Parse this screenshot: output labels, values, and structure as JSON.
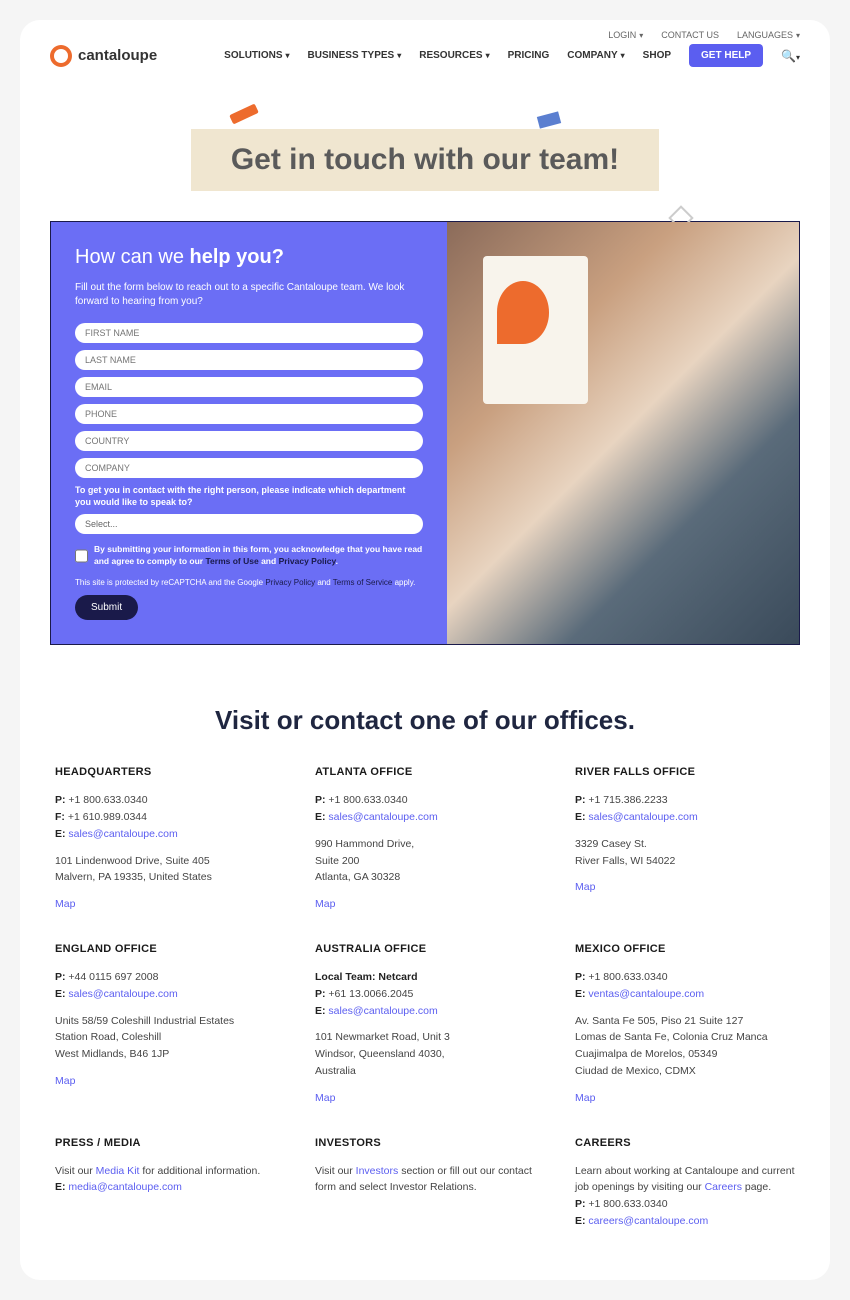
{
  "topbar": {
    "login": "LOGIN",
    "contact": "CONTACT US",
    "languages": "LANGUAGES"
  },
  "nav": {
    "logo": "cantaloupe",
    "items": [
      "SOLUTIONS",
      "BUSINESS TYPES",
      "RESOURCES",
      "PRICING",
      "COMPANY",
      "SHOP"
    ],
    "gethelp": "GET HELP"
  },
  "hero": {
    "title": "Get in touch with our team!"
  },
  "form": {
    "title_plain": "How can we ",
    "title_bold": "help you?",
    "desc": "Fill out the form below to reach out to a specific Cantaloupe team. We look forward to hearing from you?",
    "first": "FIRST NAME",
    "last": "LAST NAME",
    "email": "EMAIL",
    "phone": "PHONE",
    "country": "COUNTRY",
    "company": "COMPANY",
    "dept_label": "To get you in contact with the right person, please indicate which department you would like to speak to?",
    "select": "Select...",
    "consent_pre": "By submitting your information in this form, you acknowledge that you have read and agree to comply to our",
    "terms": "Terms of Use",
    "and": " and ",
    "privacy": "Privacy Policy",
    "captcha_pre": "This site is protected by reCAPTCHA and the Google ",
    "captcha_pp": "Privacy Policy",
    "captcha_and": " and ",
    "captcha_tos": "Terms of Service",
    "captcha_post": " apply.",
    "submit": "Submit"
  },
  "offices_title": "Visit or contact one of our offices.",
  "offices": [
    {
      "name": "HEADQUARTERS",
      "lines": [
        "P: +1 800.633.0340",
        "F: +1 610.989.0344"
      ],
      "email_label": "E: ",
      "email": "sales@cantaloupe.com",
      "addr": [
        "101 Lindenwood Drive, Suite 405",
        "Malvern, PA 19335, United States"
      ],
      "map": "Map"
    },
    {
      "name": "ATLANTA OFFICE",
      "lines": [
        "P: +1 800.633.0340"
      ],
      "email_label": "E: ",
      "email": "sales@cantaloupe.com",
      "addr": [
        "990 Hammond Drive,",
        "Suite 200",
        "Atlanta, GA 30328"
      ],
      "map": "Map"
    },
    {
      "name": "RIVER FALLS OFFICE",
      "lines": [
        "P: +1 715.386.2233"
      ],
      "email_label": "E: ",
      "email": "sales@cantaloupe.com",
      "addr": [
        "3329 Casey St.",
        "River Falls, WI 54022"
      ],
      "map": "Map"
    },
    {
      "name": "ENGLAND OFFICE",
      "lines": [
        "P: +44 0115 697 2008"
      ],
      "email_label": "E: ",
      "email": "sales@cantaloupe.com",
      "addr": [
        "Units 58/59 Coleshill Industrial Estates",
        "Station Road, Coleshill",
        "West Midlands, B46 1JP"
      ],
      "map": "Map"
    },
    {
      "name": "AUSTRALIA OFFICE",
      "local": "Local Team: Netcard",
      "lines": [
        "P: +61 13.0066.2045"
      ],
      "email_label": "E: ",
      "email": "sales@cantaloupe.com",
      "addr": [
        "101 Newmarket Road, Unit 3",
        "Windsor, Queensland 4030,",
        "Australia"
      ],
      "map": "Map"
    },
    {
      "name": "MEXICO OFFICE",
      "lines": [
        "P: +1 800.633.0340"
      ],
      "email_label": "E: ",
      "email": "ventas@cantaloupe.com",
      "addr": [
        "Av. Santa Fe 505, Piso 21 Suite 127",
        "Lomas de Santa Fe, Colonia Cruz Manca",
        "Cuajimalpa de Morelos, 05349",
        "Ciudad de Mexico, CDMX"
      ],
      "map": "Map"
    }
  ],
  "bottom": [
    {
      "name": "PRESS / MEDIA",
      "text_pre": "Visit our ",
      "link": "Media Kit",
      "text_post": " for additional information.",
      "email_label": "E: ",
      "email": "media@cantaloupe.com"
    },
    {
      "name": "INVESTORS",
      "text_pre": "Visit our ",
      "link": "Investors",
      "text_post": " section or fill out our contact form and select Investor Relations."
    },
    {
      "name": "CAREERS",
      "text_pre": "Learn about working at Cantaloupe and current job openings by visiting our ",
      "link": "Careers",
      "text_post": " page.",
      "phone": "P: +1 800.633.0340",
      "email_label": "E: ",
      "email": "careers@cantaloupe.com"
    }
  ]
}
